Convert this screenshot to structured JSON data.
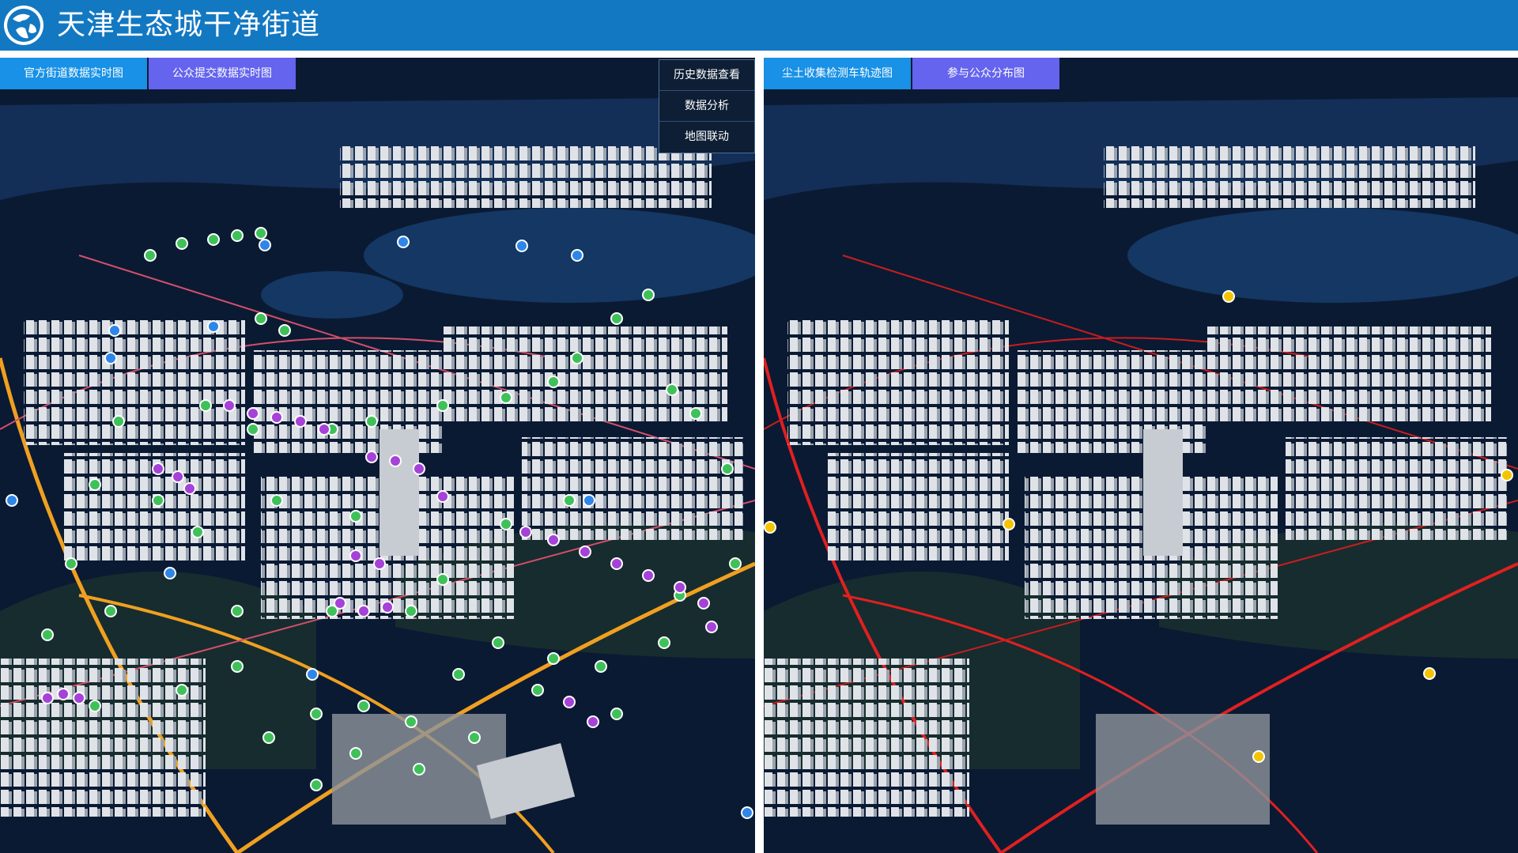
{
  "header": {
    "title": "天津生态城干净街道",
    "logo_icon": "globe-logo-icon",
    "background": "#1378c2"
  },
  "left_panel": {
    "tabs": [
      {
        "label": "官方街道数据实时图",
        "color": "#1891e6"
      },
      {
        "label": "公众提交数据实时图",
        "color": "#6464ee"
      }
    ],
    "menu": [
      {
        "label": "历史数据查看"
      },
      {
        "label": "数据分析"
      },
      {
        "label": "地图联动"
      }
    ],
    "map_markers": {
      "trash_bin_icon": "trash-bin-marker-icon",
      "trash_color": "#3fc15a",
      "public_report_icon": "building-marker-icon",
      "public_report_color": "#a542d8",
      "person_icon": "person-marker-icon",
      "person_color": "#2e86e8"
    }
  },
  "right_panel": {
    "tabs": [
      {
        "label": "尘土收集检测车轨迹图",
        "color": "#1891e6"
      },
      {
        "label": "参与公众分布图",
        "color": "#6464ee"
      }
    ],
    "map_markers": {
      "vehicle_icon": "car-marker-icon",
      "vehicle_color": "#f5c400",
      "trajectory_color": "#e02020"
    }
  },
  "map_style": {
    "background": "#0b1a33",
    "water": "#123560",
    "green": "#1e3a2c",
    "building": "#d6dbe1",
    "main_road": "#f0a020"
  }
}
